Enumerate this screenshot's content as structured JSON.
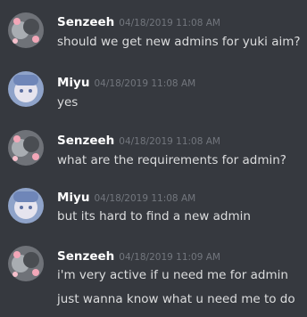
{
  "messages": [
    {
      "username": "Senzeeh",
      "timestamp": "04/18/2019 11:08 AM",
      "avatar": "senzeeh-avatar",
      "lines": [
        "should we get new admins for yuki aim?"
      ]
    },
    {
      "username": "Miyu",
      "timestamp": "04/18/2019 11:08 AM",
      "avatar": "miyu-avatar",
      "lines": [
        "yes"
      ]
    },
    {
      "username": "Senzeeh",
      "timestamp": "04/18/2019 11:08 AM",
      "avatar": "senzeeh-avatar",
      "lines": [
        "what are the requirements for admin?"
      ]
    },
    {
      "username": "Miyu",
      "timestamp": "04/18/2019 11:08 AM",
      "avatar": "miyu-avatar",
      "lines": [
        "but its hard to find a new admin"
      ]
    },
    {
      "username": "Senzeeh",
      "timestamp": "04/18/2019 11:09 AM",
      "avatar": "senzeeh-avatar",
      "lines": [
        "i'm very active if u need me for admin",
        "just wanna know what u need me to do"
      ]
    }
  ],
  "colors": {
    "background": "#36393f",
    "username": "#ffffff",
    "timestamp": "#72767d",
    "message_text": "#dcddde"
  }
}
